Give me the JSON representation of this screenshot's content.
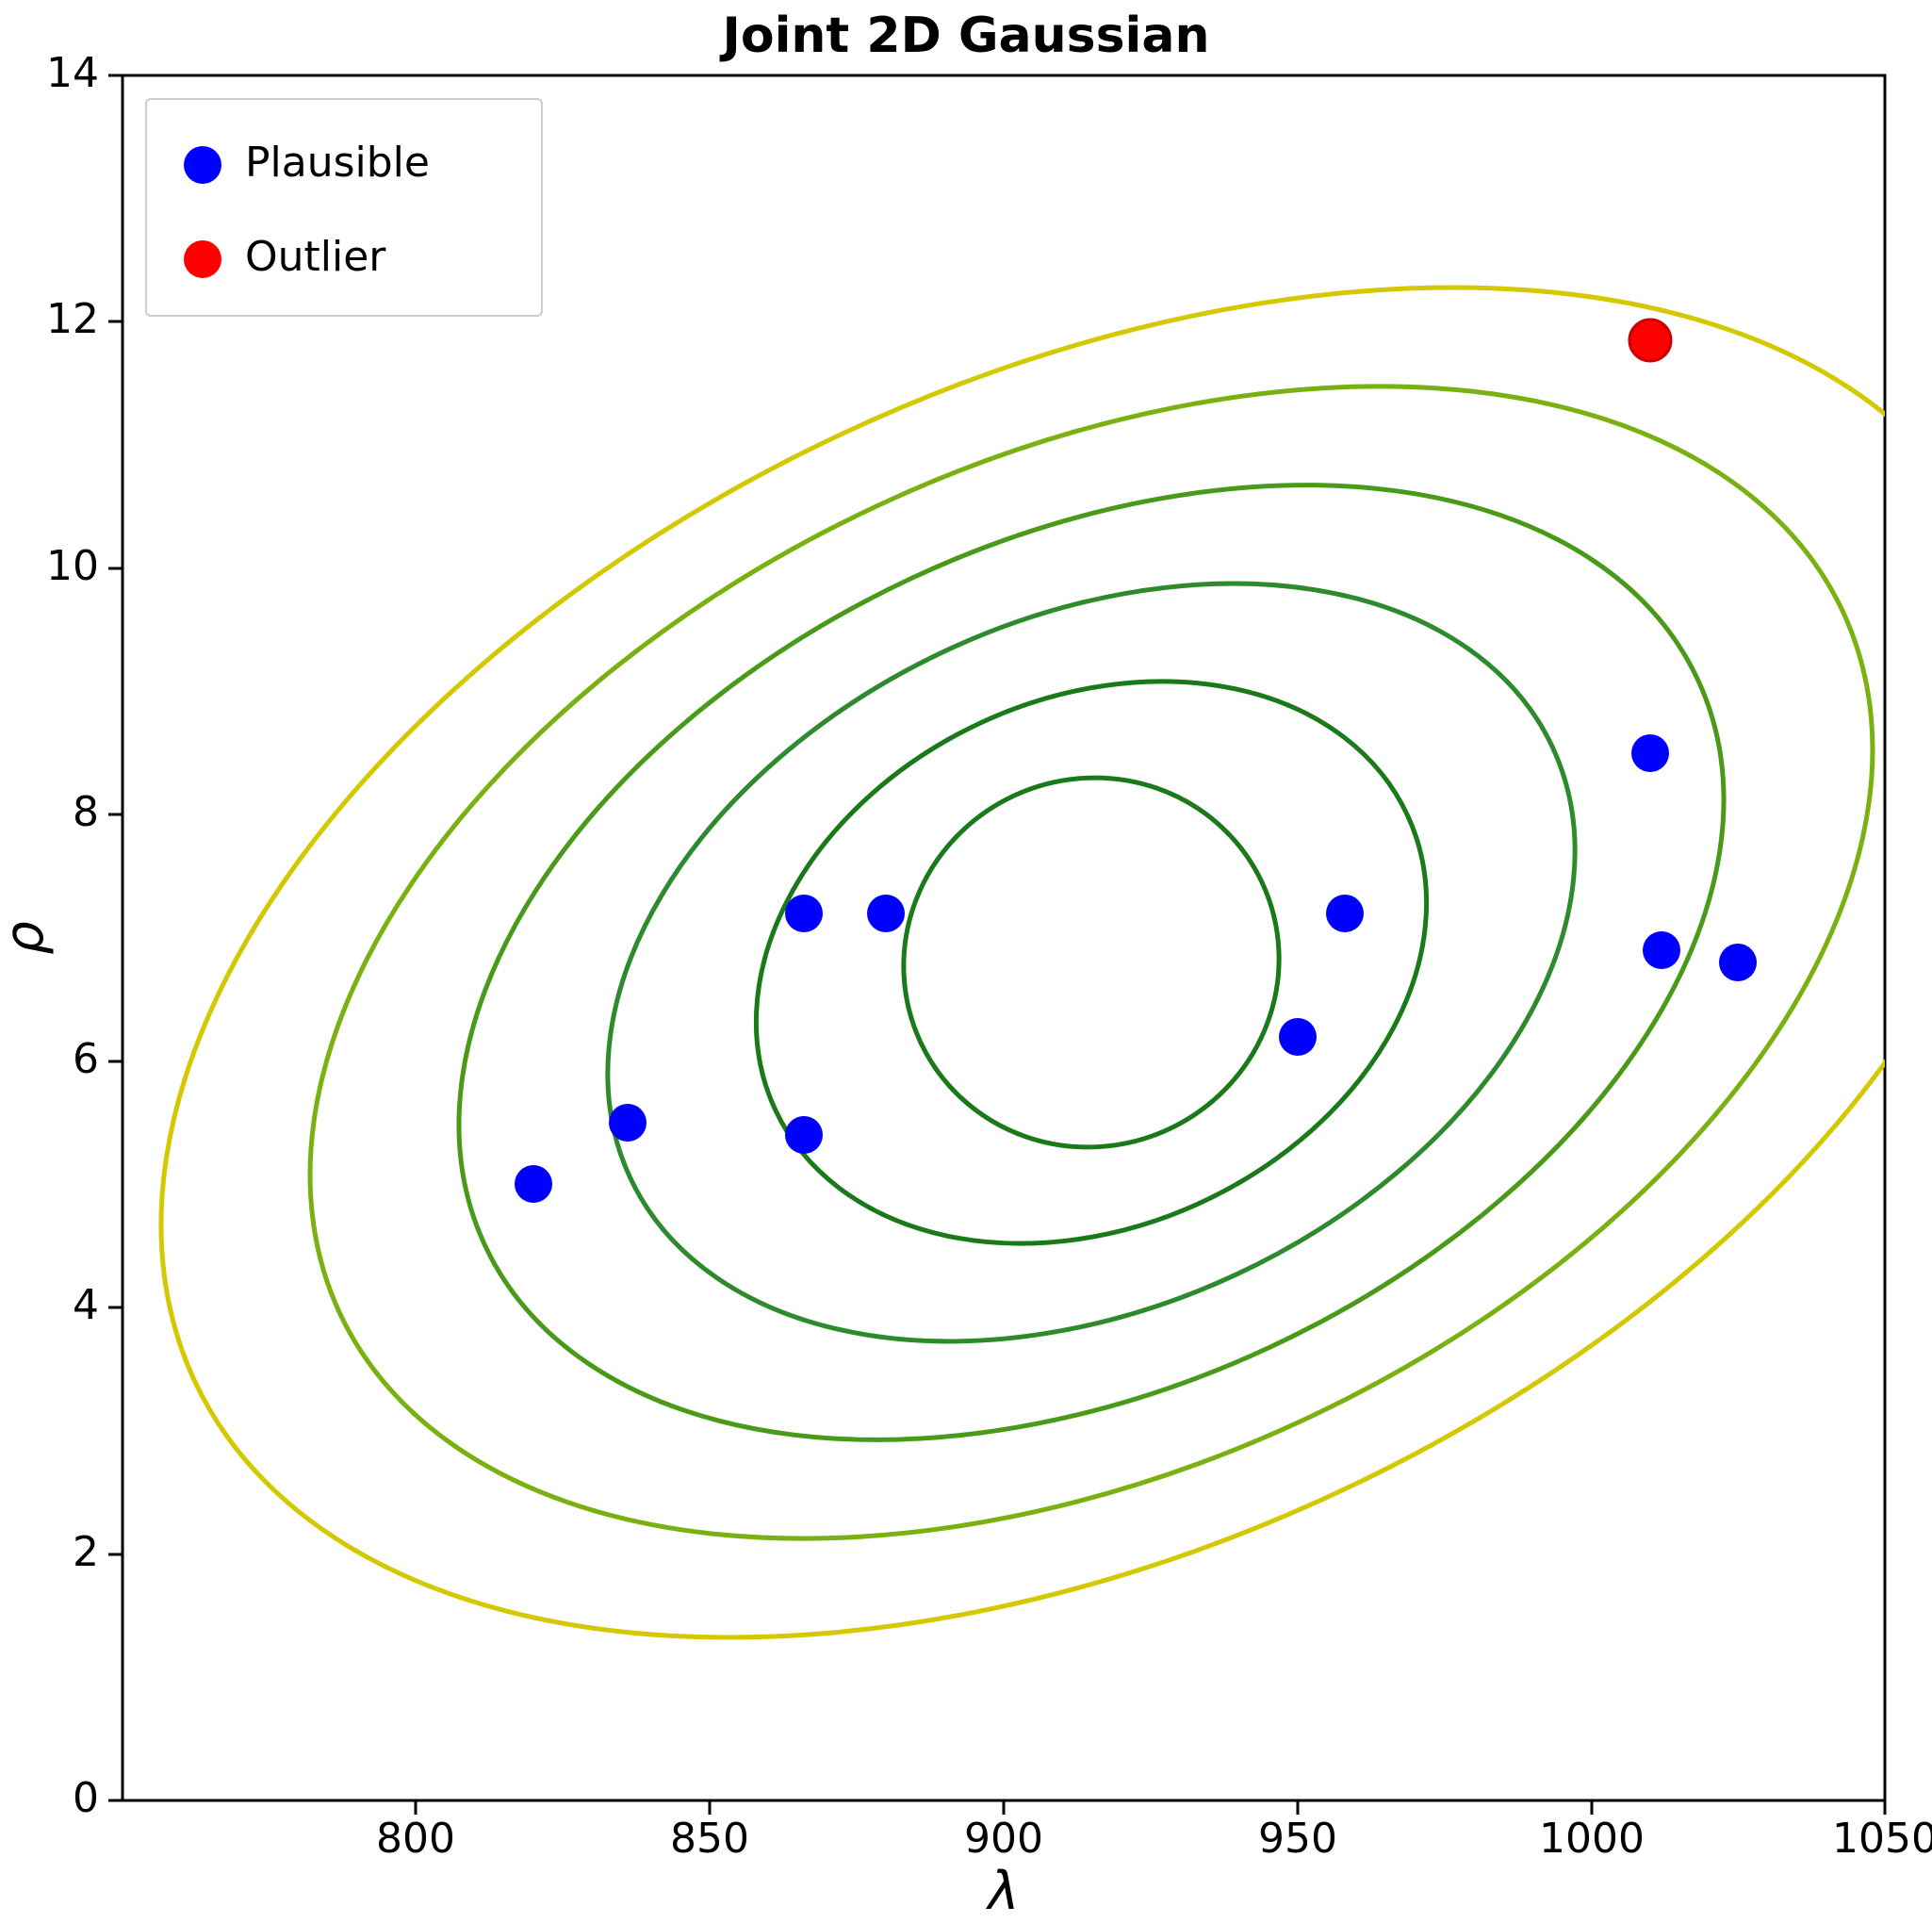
{
  "chart": {
    "title": "Joint 2D Gaussian",
    "x_label": "λ",
    "y_label": "ρ",
    "x_min": 750,
    "x_max": 1050,
    "y_min": 0,
    "y_max": 14,
    "x_ticks": [
      800,
      850,
      900,
      950,
      1000,
      1050
    ],
    "y_ticks": [
      0,
      2,
      4,
      6,
      8,
      10,
      12,
      14
    ],
    "legend": {
      "plausible_label": "Plausible",
      "outlier_label": "Outlier",
      "plausible_color": "#0000ff",
      "outlier_color": "#ff0000"
    },
    "blue_points": [
      {
        "x": 820,
        "y": 5.0
      },
      {
        "x": 836,
        "y": 5.5
      },
      {
        "x": 866,
        "y": 7.2
      },
      {
        "x": 880,
        "y": 7.2
      },
      {
        "x": 866,
        "y": 5.4
      },
      {
        "x": 950,
        "y": 6.2
      },
      {
        "x": 958,
        "y": 7.2
      },
      {
        "x": 1010,
        "y": 8.5
      },
      {
        "x": 1012,
        "y": 6.9
      },
      {
        "x": 1025,
        "y": 6.8
      }
    ],
    "red_points": [
      {
        "x": 1010,
        "y": 11.85
      }
    ]
  }
}
